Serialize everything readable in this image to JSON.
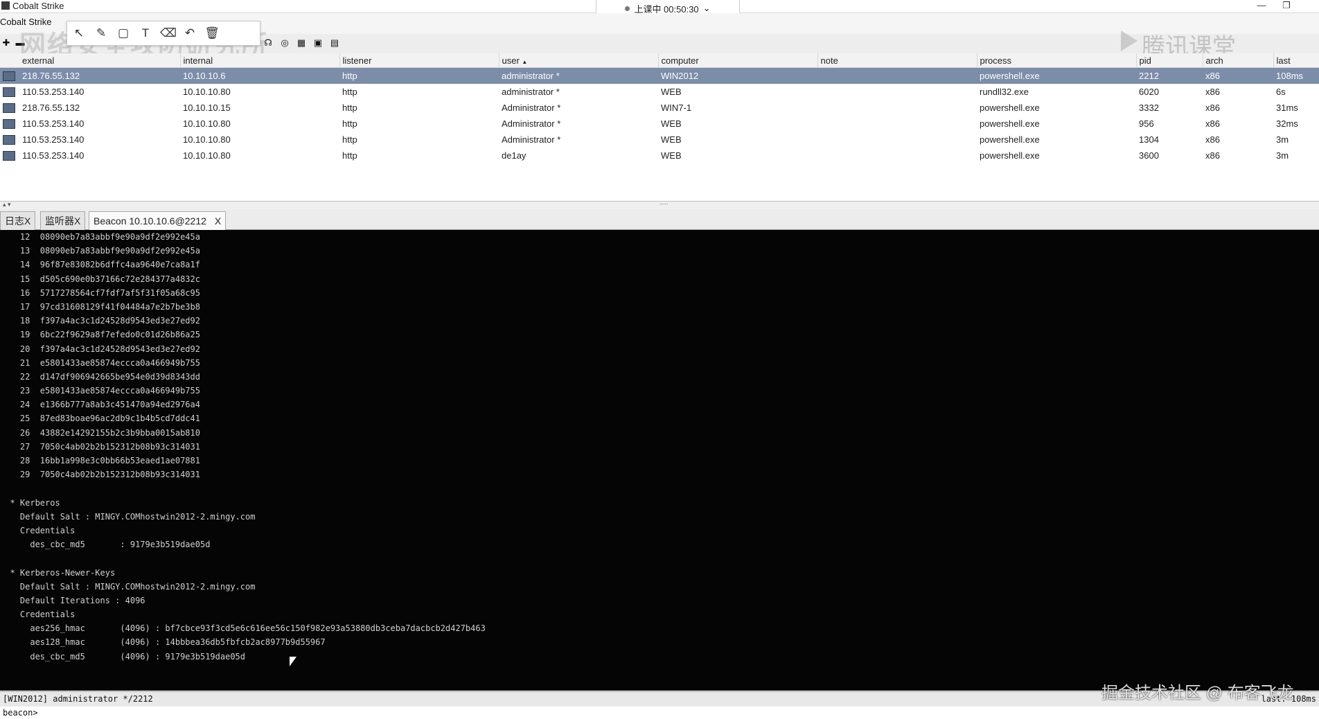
{
  "window": {
    "title": "Cobalt Strike",
    "controls": [
      "—",
      "❐"
    ]
  },
  "overlay": {
    "status": "上课中 00:50:30",
    "chevron": "⌄"
  },
  "menubar": {
    "items": [
      "Cobalt Strike"
    ]
  },
  "toolbar": {
    "icons": [
      "plus-icon",
      "minus-icon",
      "headphones-icon",
      "target-icon",
      "grid-icon"
    ]
  },
  "draw_tools": {
    "icons": [
      "cursor-icon",
      "pen-icon",
      "rectangle-icon",
      "text-icon",
      "eraser-icon",
      "undo-icon",
      "delete-icon"
    ],
    "glyphs": [
      "↖",
      "✎",
      "▢",
      "T",
      "⌫",
      "↶",
      "🗑"
    ]
  },
  "watermarks": {
    "left": "网络安全攻防研究所",
    "right": "腾讯课堂",
    "bottom": "掘金技术社区 @ 布客飞龙"
  },
  "sessions": {
    "columns": [
      "external",
      "internal",
      "listener",
      "user",
      "computer",
      "note",
      "process",
      "pid",
      "arch",
      "last"
    ],
    "sort_indicator": "▲",
    "rows": [
      {
        "external": "218.76.55.132",
        "internal": "10.10.10.6",
        "listener": "http",
        "user": "administrator *",
        "computer": "WIN2012",
        "note": "",
        "process": "powershell.exe",
        "pid": "2212",
        "arch": "x86",
        "last": "108ms",
        "selected": true
      },
      {
        "external": "110.53.253.140",
        "internal": "10.10.10.80",
        "listener": "http",
        "user": "administrator *",
        "computer": "WEB",
        "note": "",
        "process": "rundll32.exe",
        "pid": "6020",
        "arch": "x86",
        "last": "6s",
        "selected": false
      },
      {
        "external": "218.76.55.132",
        "internal": "10.10.10.15",
        "listener": "http",
        "user": "Administrator *",
        "computer": "WIN7-1",
        "note": "",
        "process": "powershell.exe",
        "pid": "3332",
        "arch": "x86",
        "last": "31ms",
        "selected": false
      },
      {
        "external": "110.53.253.140",
        "internal": "10.10.10.80",
        "listener": "http",
        "user": "Administrator *",
        "computer": "WEB",
        "note": "",
        "process": "powershell.exe",
        "pid": "956",
        "arch": "x86",
        "last": "32ms",
        "selected": false
      },
      {
        "external": "110.53.253.140",
        "internal": "10.10.10.80",
        "listener": "http",
        "user": "Administrator *",
        "computer": "WEB",
        "note": "",
        "process": "powershell.exe",
        "pid": "1304",
        "arch": "x86",
        "last": "3m",
        "selected": false
      },
      {
        "external": "110.53.253.140",
        "internal": "10.10.10.80",
        "listener": "http",
        "user": "de1ay",
        "computer": "WEB",
        "note": "",
        "process": "powershell.exe",
        "pid": "3600",
        "arch": "x86",
        "last": "3m",
        "selected": false
      }
    ]
  },
  "splitter": {
    "arrows": "▴ ▾",
    "grip": "....."
  },
  "tabs": [
    {
      "label": "日志",
      "close": "X",
      "active": false
    },
    {
      "label": "监听器",
      "close": "X",
      "active": false
    },
    {
      "label": "Beacon 10.10.10.6@2212",
      "close": "X",
      "active": true
    }
  ],
  "console_lines": [
    "    12  08090eb7a83abbf9e90a9df2e992e45a",
    "    13  08090eb7a83abbf9e90a9df2e992e45a",
    "    14  96f87e83082b6dffc4aa9640e7ca8a1f",
    "    15  d505c690e0b37166c72e284377a4832c",
    "    16  5717278564cf7fdf7af5f31f05a68c95",
    "    17  97cd31608129f41f04484a7e2b7be3b8",
    "    18  f397a4ac3c1d24528d9543ed3e27ed92",
    "    19  6bc22f9629a8f7efedo0c01d26b86a25",
    "    20  f397a4ac3c1d24528d9543ed3e27ed92",
    "    21  e5801433ae85874eccca0a466949b755",
    "    22  d147df906942665be954e0d39d8343dd",
    "    23  e5801433ae85874eccca0a466949b755",
    "    24  e1366b777a8ab3c451470a94ed2976a4",
    "    25  87ed83boae96ac2db9c1b4b5cd7ddc41",
    "    26  43882e14292155b2c3b9bba0015ab810",
    "    27  7050c4ab02b2b152312b08b93c314031",
    "    28  16bb1a998e3c0bb66b53eaed1ae07881",
    "    29  7050c4ab02b2b152312b08b93c314031",
    "",
    "  * Kerberos",
    "    Default Salt : MINGY.COMhostwin2012-2.mingy.com",
    "    Credentials",
    "      des_cbc_md5       : 9179e3b519dae05d",
    "",
    "  * Kerberos-Newer-Keys",
    "    Default Salt : MINGY.COMhostwin2012-2.mingy.com",
    "    Default Iterations : 4096",
    "    Credentials",
    "      aes256_hmac       (4096) : bf7cbce93f3cd5e6c616ee56c150f982e93a53880db3ceba7dacbcb2d427b463",
    "      aes128_hmac       (4096) : 14bbbea36db5fbfcb2ac8977b9d55967",
    "      des_cbc_md5       (4096) : 9179e3b519dae05d"
  ],
  "statusbar": {
    "left": "[WIN2012] administrator */2212",
    "right": "last: 108ms"
  },
  "prompt": {
    "text": "beacon>"
  },
  "colors": {
    "selected_row": "#7c8da9",
    "console_bg": "#050505",
    "console_fg": "#d0d0d0"
  }
}
